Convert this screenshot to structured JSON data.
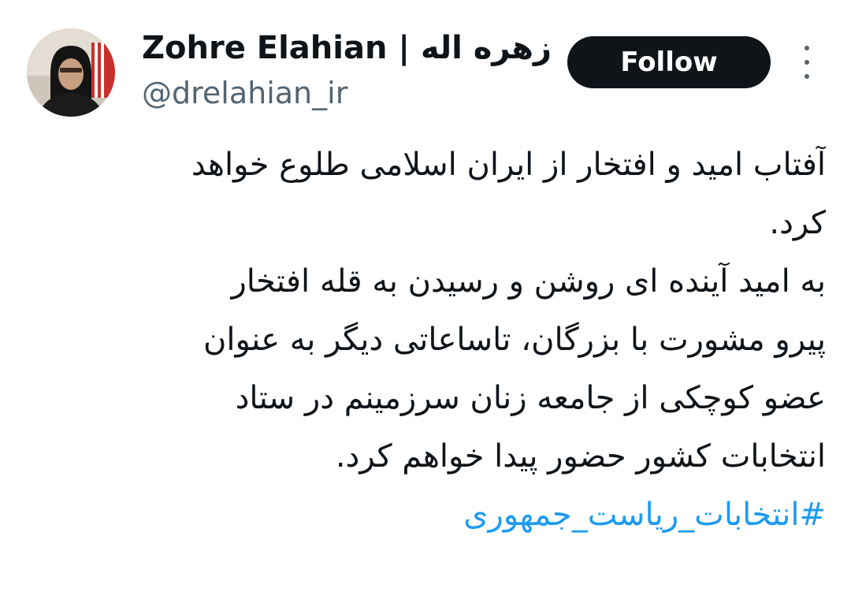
{
  "author": {
    "display_name": "Zohre Elahian | زهره اله...",
    "handle": "@drelahian_ir",
    "avatar_icon": "profile-photo"
  },
  "actions": {
    "follow_label": "Follow",
    "more_icon": "vertical-ellipsis-icon"
  },
  "tweet": {
    "lines": [
      "آفتاب امید و افتخار از ایران اسلامی طلوع خواهد",
      "کرد.",
      "به امید آینده ای روشن و رسیدن به قله افتخار",
      "پیرو مشورت با بزرگان، تاساعاتی دیگر به عنوان",
      "عضو کوچکی از جامعه  زنان سرزمینم در ستاد",
      "انتخابات کشور حضور پیدا خواهم کرد."
    ],
    "hashtag": "#انتخابات_ریاست_جمهوری"
  },
  "colors": {
    "text": "#0f1419",
    "secondary_text": "#536471",
    "link": "#1d9bf0",
    "button_bg": "#0f1419",
    "button_text": "#ffffff"
  }
}
